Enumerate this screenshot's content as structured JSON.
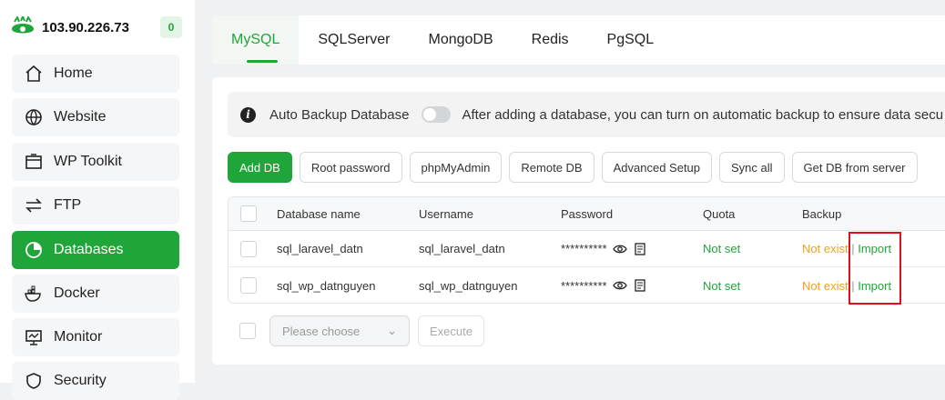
{
  "sidebar": {
    "server_ip": "103.90.226.73",
    "badge_count": "0",
    "items": [
      {
        "label": "Home",
        "icon": "home-icon"
      },
      {
        "label": "Website",
        "icon": "globe-icon"
      },
      {
        "label": "WP Toolkit",
        "icon": "wordpress-toolkit-icon"
      },
      {
        "label": "FTP",
        "icon": "transfer-arrows-icon"
      },
      {
        "label": "Databases",
        "icon": "database-pie-icon"
      },
      {
        "label": "Docker",
        "icon": "docker-icon"
      },
      {
        "label": "Monitor",
        "icon": "monitor-icon"
      },
      {
        "label": "Security",
        "icon": "shield-icon"
      }
    ],
    "active_item": "Databases"
  },
  "tabs": [
    "MySQL",
    "SQLServer",
    "MongoDB",
    "Redis",
    "PgSQL"
  ],
  "active_tab": "MySQL",
  "alert": {
    "label": "Auto Backup Database",
    "message": "After adding a database, you can turn on automatic backup to ensure data secu"
  },
  "toolbar": {
    "add_db": "Add DB",
    "root_password": "Root password",
    "phpmyadmin": "phpMyAdmin",
    "remote_db": "Remote DB",
    "advanced_setup": "Advanced Setup",
    "sync_all": "Sync all",
    "get_db_from_server": "Get DB from server"
  },
  "table": {
    "headers": {
      "name": "Database name",
      "username": "Username",
      "password": "Password",
      "quota": "Quota",
      "backup": "Backup"
    },
    "rows": [
      {
        "name": "sql_laravel_datn",
        "username": "sql_laravel_datn",
        "password": "**********",
        "quota": "Not set",
        "backup_status": "Not exist",
        "separator": "|",
        "import": "Import"
      },
      {
        "name": "sql_wp_datnguyen",
        "username": "sql_wp_datnguyen",
        "password": "**********",
        "quota": "Not set",
        "backup_status": "Not exist",
        "separator": "|",
        "import": "Import"
      }
    ]
  },
  "batch": {
    "placeholder": "Please choose",
    "execute": "Execute"
  },
  "colors": {
    "accent": "#20a53a",
    "warning": "#f0a020",
    "highlight": "#e0101a"
  }
}
